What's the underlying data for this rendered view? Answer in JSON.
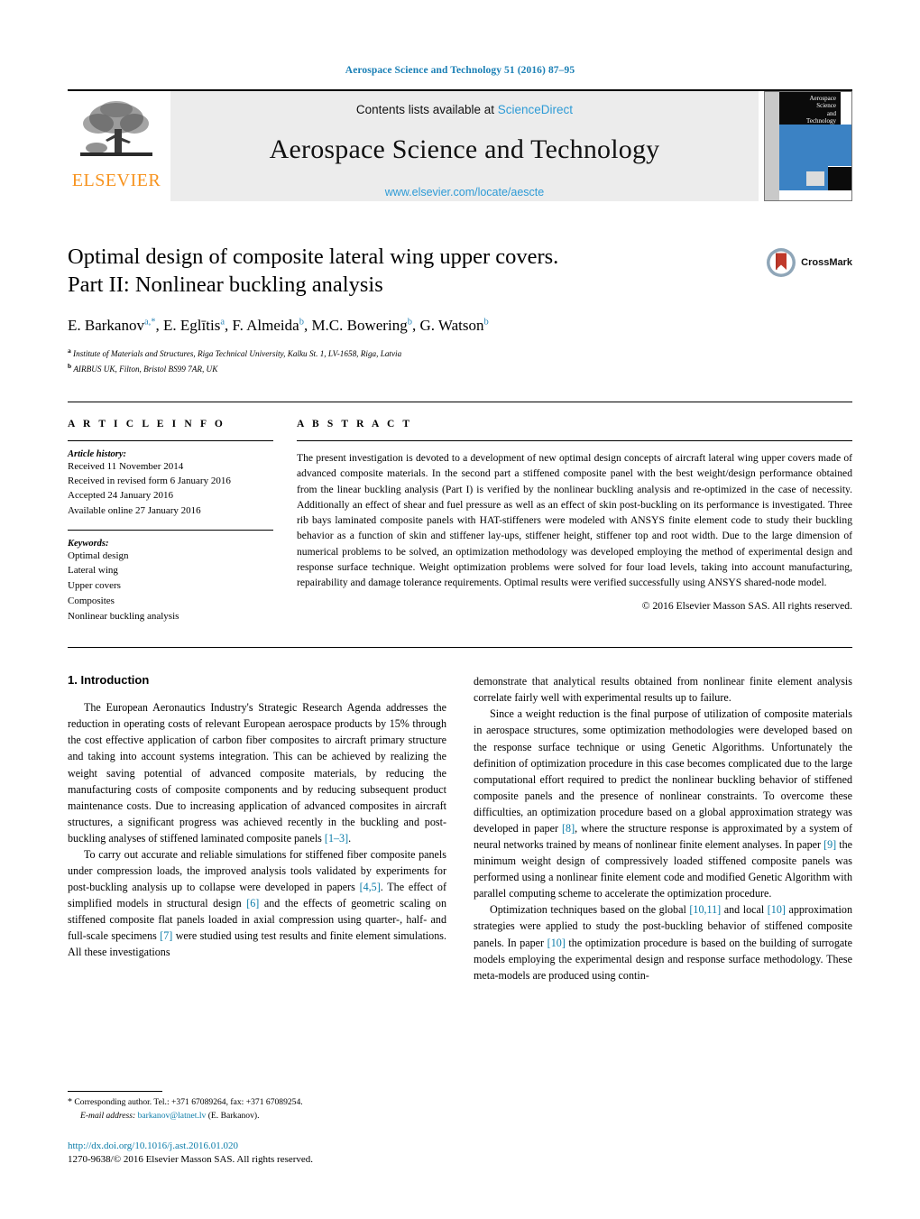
{
  "running_head": "Aerospace Science and Technology 51 (2016) 87–95",
  "masthead": {
    "publisher_logo_text": "ELSEVIER",
    "contents_prefix": "Contents lists available at",
    "contents_link": "ScienceDirect",
    "journal_title": "Aerospace Science and Technology",
    "journal_url": "www.elsevier.com/locate/aescte",
    "cover_title_line1": "Aerospace",
    "cover_title_line2": "Science",
    "cover_title_line3": "and",
    "cover_title_line4": "Technology"
  },
  "article": {
    "title_line1": "Optimal design of composite lateral wing upper covers.",
    "title_line2": "Part II: Nonlinear buckling analysis",
    "crossmark_label": "CrossMark",
    "authors": [
      {
        "name": "E. Barkanov",
        "sup": "a,*"
      },
      {
        "name": "E. Eglītis",
        "sup": "a"
      },
      {
        "name": "F. Almeida",
        "sup": "b"
      },
      {
        "name": "M.C. Bowering",
        "sup": "b"
      },
      {
        "name": "G. Watson",
        "sup": "b"
      }
    ],
    "affiliations": [
      {
        "marker": "a",
        "text": "Institute of Materials and Structures, Riga Technical University, Kalku St. 1, LV-1658, Riga, Latvia"
      },
      {
        "marker": "b",
        "text": "AIRBUS UK, Filton, Bristol BS99 7AR, UK"
      }
    ]
  },
  "article_info": {
    "label": "A R T I C L E    I N F O",
    "history_head": "Article history:",
    "history": [
      "Received 11 November 2014",
      "Received in revised form 6 January 2016",
      "Accepted 24 January 2016",
      "Available online 27 January 2016"
    ],
    "keywords_head": "Keywords:",
    "keywords": [
      "Optimal design",
      "Lateral wing",
      "Upper covers",
      "Composites",
      "Nonlinear buckling analysis"
    ]
  },
  "abstract": {
    "label": "A B S T R A C T",
    "text": "The present investigation is devoted to a development of new optimal design concepts of aircraft lateral wing upper covers made of advanced composite materials. In the second part a stiffened composite panel with the best weight/design performance obtained from the linear buckling analysis (Part I) is verified by the nonlinear buckling analysis and re-optimized in the case of necessity. Additionally an effect of shear and fuel pressure as well as an effect of skin post-buckling on its performance is investigated. Three rib bays laminated composite panels with HAT-stiffeners were modeled with ANSYS finite element code to study their buckling behavior as a function of skin and stiffener lay-ups, stiffener height, stiffener top and root width. Due to the large dimension of numerical problems to be solved, an optimization methodology was developed employing the method of experimental design and response surface technique. Weight optimization problems were solved for four load levels, taking into account manufacturing, repairability and damage tolerance requirements. Optimal results were verified successfully using ANSYS shared-node model.",
    "copyright": "© 2016 Elsevier Masson SAS. All rights reserved."
  },
  "body": {
    "section_heading": "1. Introduction",
    "left_paragraphs": [
      {
        "segments": [
          {
            "t": "The European Aeronautics Industry's Strategic Research Agenda addresses the reduction in operating costs of relevant European aerospace products by 15% through the cost effective application of carbon fiber composites to aircraft primary structure and taking into account systems integration. This can be achieved by realizing the weight saving potential of advanced composite materials, by reducing the manufacturing costs of composite components and by reducing subsequent product maintenance costs. Due to increasing application of advanced composites in aircraft structures, a significant progress was achieved recently in the buckling and post-buckling analyses of stiffened laminated composite panels "
          },
          {
            "t": "[1–3]",
            "cite": true
          },
          {
            "t": "."
          }
        ]
      },
      {
        "segments": [
          {
            "t": "To carry out accurate and reliable simulations for stiffened fiber composite panels under compression loads, the improved analysis tools validated by experiments for post-buckling analysis up to collapse were developed in papers "
          },
          {
            "t": "[4,5]",
            "cite": true
          },
          {
            "t": ". The effect of simplified models in structural design "
          },
          {
            "t": "[6]",
            "cite": true
          },
          {
            "t": " and the effects of geometric scaling on stiffened composite flat panels loaded in axial compression using quarter-, half- and full-scale specimens "
          },
          {
            "t": "[7]",
            "cite": true
          },
          {
            "t": " were studied using test results and finite element simulations. All these investigations"
          }
        ]
      }
    ],
    "right_paragraphs": [
      {
        "segments": [
          {
            "t": "demonstrate that analytical results obtained from nonlinear finite element analysis correlate fairly well with experimental results up to failure.",
            "noindent": true
          }
        ]
      },
      {
        "segments": [
          {
            "t": "Since a weight reduction is the final purpose of utilization of composite materials in aerospace structures, some optimization methodologies were developed based on the response surface technique or using Genetic Algorithms. Unfortunately the definition of optimization procedure in this case becomes complicated due to the large computational effort required to predict the nonlinear buckling behavior of stiffened composite panels and the presence of nonlinear constraints. To overcome these difficulties, an optimization procedure based on a global approximation strategy was developed in paper "
          },
          {
            "t": "[8]",
            "cite": true
          },
          {
            "t": ", where the structure response is approximated by a system of neural networks trained by means of nonlinear finite element analyses. In paper "
          },
          {
            "t": "[9]",
            "cite": true
          },
          {
            "t": " the minimum weight design of compressively loaded stiffened composite panels was performed using a nonlinear finite element code and modified Genetic Algorithm with parallel computing scheme to accelerate the optimization procedure."
          }
        ]
      },
      {
        "segments": [
          {
            "t": "Optimization techniques based on the global "
          },
          {
            "t": "[10,11]",
            "cite": true
          },
          {
            "t": " and local "
          },
          {
            "t": "[10]",
            "cite": true
          },
          {
            "t": " approximation strategies were applied to study the post-buckling behavior of stiffened composite panels. In paper "
          },
          {
            "t": "[10]",
            "cite": true
          },
          {
            "t": " the optimization procedure is based on the building of surrogate models employing the experimental design and response surface methodology. These meta-models are produced using contin-"
          }
        ]
      }
    ]
  },
  "footnotes": {
    "corresponding_star": "*",
    "corresponding_text": "Corresponding author. Tel.: +371 67089264, fax: +371 67089254.",
    "email_label": "E-mail address:",
    "email": "barkanov@latnet.lv",
    "email_suffix": "(E. Barkanov).",
    "doi": "http://dx.doi.org/10.1016/j.ast.2016.01.020",
    "issn_line": "1270-9638/© 2016 Elsevier Masson SAS. All rights reserved."
  },
  "colors": {
    "link_blue": "#2e9bd6",
    "cite_blue": "#0a7ba8",
    "running_head_blue": "#1a7fb5",
    "elsevier_orange": "#f7931e",
    "cover_blue": "#3b82c4",
    "crossmark_red": "#c0392b"
  }
}
